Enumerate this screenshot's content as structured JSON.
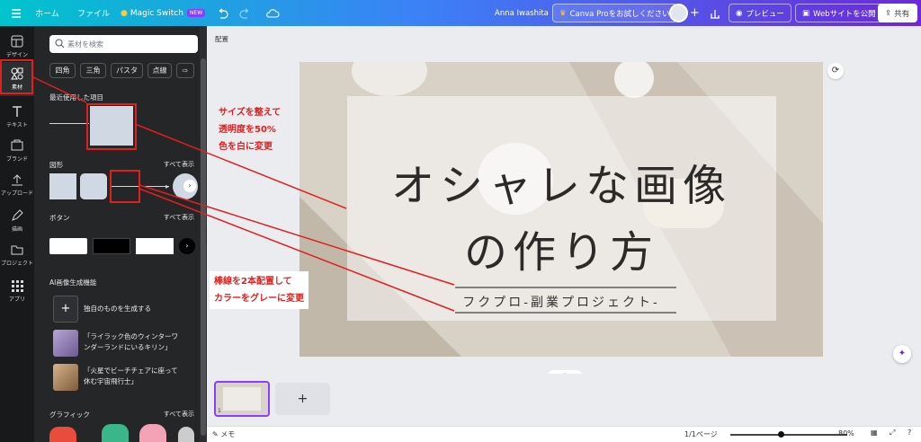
{
  "topbar": {
    "menu_icon": "hamburger-icon",
    "home": "ホーム",
    "file": "ファイル",
    "magic_switch": "Magic Switch",
    "new_badge": "NEW",
    "user_name": "Anna Iwashita",
    "canva_pro": "Canva Proをお試しください",
    "preview": "プレビュー",
    "publish": "Webサイトを公開",
    "share": "共有"
  },
  "rail": {
    "items": [
      {
        "label": "デザイン",
        "icon": "layout-icon"
      },
      {
        "label": "素材",
        "icon": "elements-icon"
      },
      {
        "label": "テキスト",
        "icon": "text-icon"
      },
      {
        "label": "ブランド",
        "icon": "brand-icon"
      },
      {
        "label": "アップロード",
        "icon": "upload-icon"
      },
      {
        "label": "描画",
        "icon": "draw-icon"
      },
      {
        "label": "プロジェクト",
        "icon": "folder-icon"
      },
      {
        "label": "アプリ",
        "icon": "apps-icon"
      }
    ]
  },
  "panel": {
    "search_placeholder": "素材を検索",
    "chips": [
      "四角",
      "三角",
      "パスタ",
      "点線"
    ],
    "recent_title": "最近使用した項目",
    "shapes_title": "図形",
    "buttons_title": "ボタン",
    "see_all": "すべて表示",
    "ai_title": "AI画像生成機能",
    "ai_items": [
      "独自のものを生成する",
      "「ライラック色のウィンターワ\nンダーランドにいるキリン」",
      "「火星でビーチチェアに座って\n休む宇宙飛行士」"
    ],
    "graphics_title": "グラフィック"
  },
  "workspace": {
    "position_label": "配置",
    "title_line1": "オシャレな画像",
    "title_line2": "の作り方",
    "subtitle": "フクプロ-副業プロジェクト-"
  },
  "annotations": {
    "note1": [
      "サイズを整えて",
      "透明度を50%",
      "色を白に変更"
    ],
    "note2": [
      "棒線を2本配置して",
      "カラーをグレーに変更"
    ]
  },
  "status": {
    "memo": "メモ",
    "pages": "1/1ページ",
    "zoom": "80%",
    "page_number": "1"
  },
  "colors": {
    "annotation_red": "#e02020",
    "rail_bg": "#18191b",
    "panel_bg": "#252627",
    "brand_purple": "#8b3dff"
  }
}
